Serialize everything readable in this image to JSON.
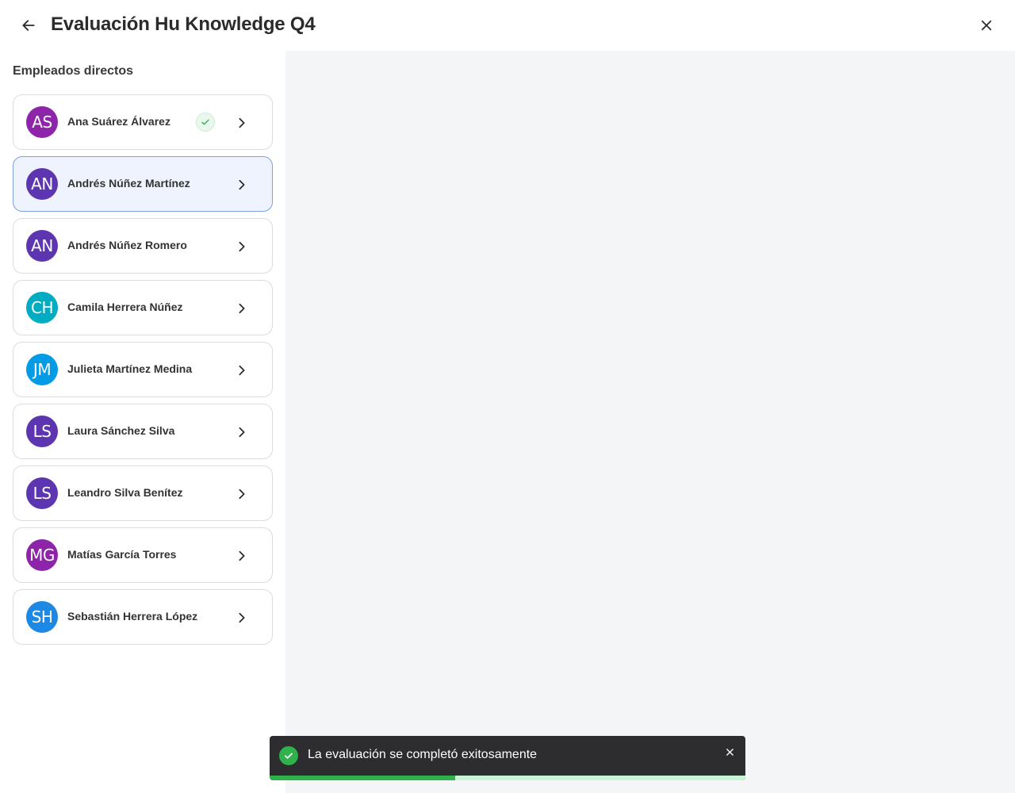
{
  "header": {
    "title": "Evaluación Hu Knowledge Q4",
    "back_icon": "arrow-left-icon",
    "close_icon": "close-icon"
  },
  "sidebar": {
    "section_title": "Empleados directos",
    "employees": [
      {
        "initials": "AS",
        "name": "Ana Suárez Álvarez",
        "color": "#8e24aa",
        "completed": true,
        "selected": false
      },
      {
        "initials": "AN",
        "name": "Andrés Núñez Martínez",
        "color": "#5e35b1",
        "completed": false,
        "selected": true
      },
      {
        "initials": "AN",
        "name": "Andrés Núñez Romero",
        "color": "#5e35b1",
        "completed": false,
        "selected": false
      },
      {
        "initials": "CH",
        "name": "Camila Herrera Núñez",
        "color": "#00acc1",
        "completed": false,
        "selected": false
      },
      {
        "initials": "JM",
        "name": "Julieta Martínez Medina",
        "color": "#039be5",
        "completed": false,
        "selected": false
      },
      {
        "initials": "LS",
        "name": "Laura Sánchez Silva",
        "color": "#5e35b1",
        "completed": false,
        "selected": false
      },
      {
        "initials": "LS",
        "name": "Leandro Silva Benítez",
        "color": "#5e35b1",
        "completed": false,
        "selected": false
      },
      {
        "initials": "MG",
        "name": "Matías García Torres",
        "color": "#8e24aa",
        "completed": false,
        "selected": false
      },
      {
        "initials": "SH",
        "name": "Sebastián Herrera López",
        "color": "#1e88e5",
        "completed": false,
        "selected": false
      }
    ]
  },
  "toast": {
    "message": "La evaluación se completó exitosamente",
    "icon": "check-circle-icon",
    "close_icon": "close-icon",
    "progress": 0.39,
    "success_color": "#2fb14c"
  }
}
